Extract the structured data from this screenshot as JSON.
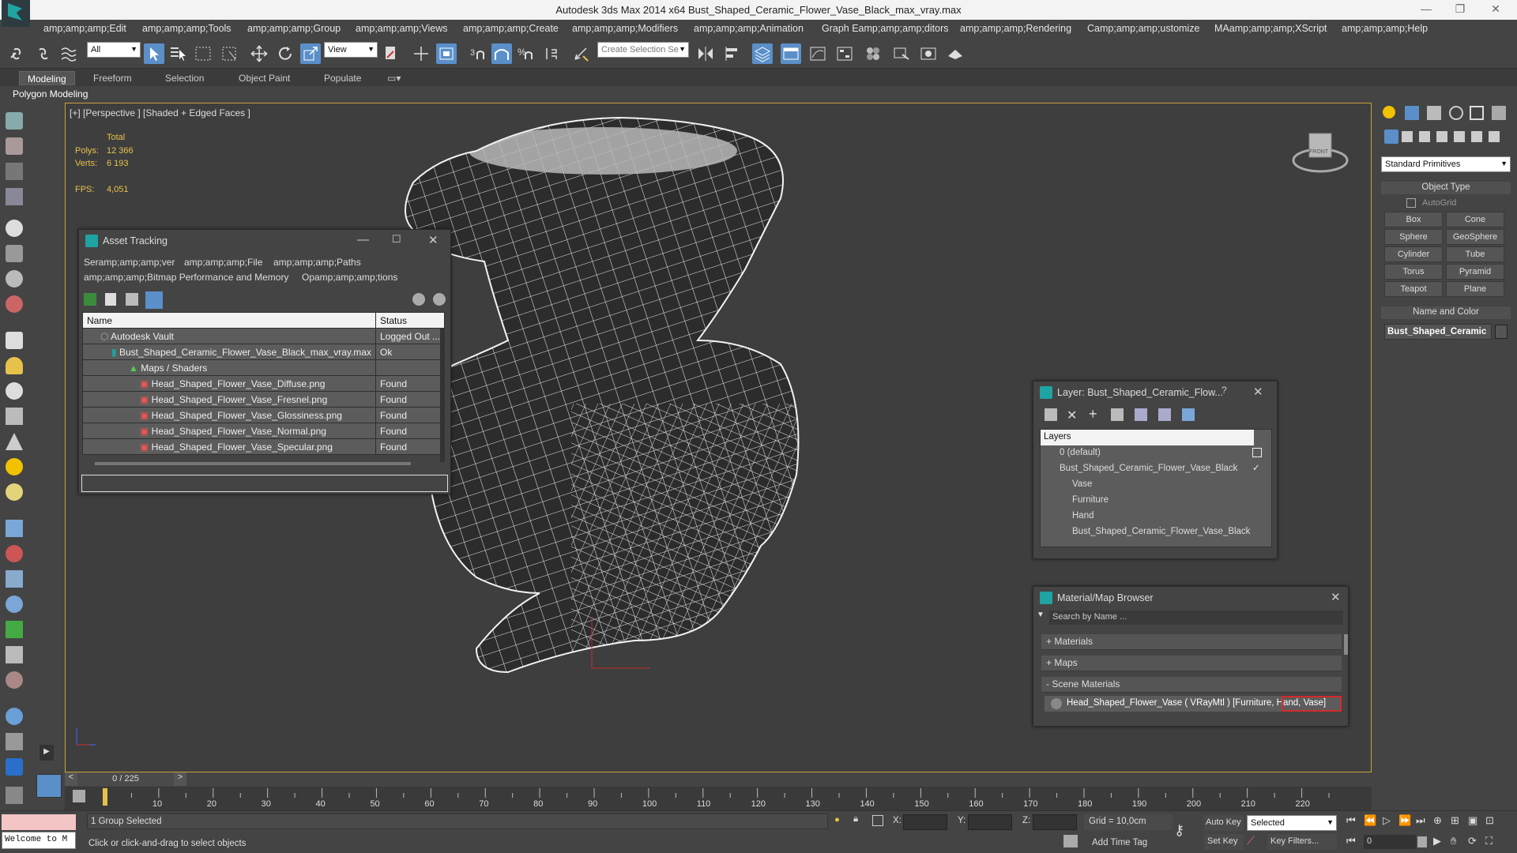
{
  "window": {
    "title": "Autodesk 3ds Max  2014 x64     Bust_Shaped_Ceramic_Flower_Vase_Black_max_vray.max"
  },
  "menu": [
    "amp;amp;amp;Edit",
    "amp;amp;amp;Tools",
    "amp;amp;amp;Group",
    "amp;amp;amp;Views",
    "amp;amp;amp;Create",
    "amp;amp;amp;Modifiers",
    "amp;amp;amp;Animation",
    "Graph Eamp;amp;amp;ditors",
    "amp;amp;amp;Rendering",
    "Camp;amp;amp;ustomize",
    "MAamp;amp;amp;XScript",
    "amp;amp;amp;Help"
  ],
  "toolbar": {
    "selection_filter": "All",
    "ref_coord": "View",
    "named_selection_placeholder": "Create Selection Se"
  },
  "ribbon": {
    "tabs": [
      "Modeling",
      "Freeform",
      "Selection",
      "Object Paint",
      "Populate"
    ],
    "active": "Modeling",
    "sub_label": "Polygon Modeling"
  },
  "viewport": {
    "label": "[+] [Perspective ] [Shaded + Edged Faces ]",
    "stats": {
      "total_label": "Total",
      "polys_label": "Polys:",
      "polys": "12 366",
      "verts_label": "Verts:",
      "verts": "6 193",
      "fps_label": "FPS:",
      "fps": "4,051"
    },
    "viewcube_label": "FRONT"
  },
  "asset_tracking": {
    "title": "Asset Tracking",
    "menu_row1": [
      "Seramp;amp;amp;ver",
      "amp;amp;amp;File",
      "amp;amp;amp;Paths"
    ],
    "menu_row2": [
      "amp;amp;amp;Bitmap Performance and Memory",
      "Opamp;amp;amp;tions"
    ],
    "columns": [
      "Name",
      "Status"
    ],
    "rows": [
      {
        "name": "Autodesk Vault",
        "status": "Logged Out ..."
      },
      {
        "name": "Bust_Shaped_Ceramic_Flower_Vase_Black_max_vray.max",
        "status": "Ok"
      },
      {
        "name": "Maps / Shaders",
        "status": ""
      },
      {
        "name": "Head_Shaped_Flower_Vase_Diffuse.png",
        "status": "Found"
      },
      {
        "name": "Head_Shaped_Flower_Vase_Fresnel.png",
        "status": "Found"
      },
      {
        "name": "Head_Shaped_Flower_Vase_Glossiness.png",
        "status": "Found"
      },
      {
        "name": "Head_Shaped_Flower_Vase_Normal.png",
        "status": "Found"
      },
      {
        "name": "Head_Shaped_Flower_Vase_Specular.png",
        "status": "Found"
      }
    ]
  },
  "layer_dialog": {
    "title": "Layer: Bust_Shaped_Ceramic_Flow...",
    "help": "?",
    "header": "Layers",
    "layers": [
      "0 (default)",
      "Bust_Shaped_Ceramic_Flower_Vase_Black",
      "Vase",
      "Furniture",
      "Hand",
      "Bust_Shaped_Ceramic_Flower_Vase_Black"
    ]
  },
  "material_browser": {
    "title": "Material/Map Browser",
    "search_placeholder": "Search by Name ...",
    "sections": [
      "+ Materials",
      "+ Maps",
      "- Scene Materials"
    ],
    "scene_material": "Head_Shaped_Flower_Vase  ( VRayMtl )  [Furniture, Hand, Vase]"
  },
  "command_panel": {
    "category": "Standard Primitives",
    "object_type_title": "Object Type",
    "autogrid": "AutoGrid",
    "buttons": [
      "Box",
      "Cone",
      "Sphere",
      "GeoSphere",
      "Cylinder",
      "Tube",
      "Torus",
      "Pyramid",
      "Teapot",
      "Plane"
    ],
    "name_color_title": "Name and Color",
    "object_name": "Bust_Shaped_Ceramic"
  },
  "timeline": {
    "frame_display": "0 / 225",
    "prev": "<",
    "next": ">",
    "ticks": [
      "10",
      "20",
      "30",
      "40",
      "50",
      "60",
      "70",
      "80",
      "90",
      "100",
      "110",
      "120",
      "130",
      "140",
      "150",
      "160",
      "170",
      "180",
      "190",
      "200",
      "210",
      "220"
    ]
  },
  "status": {
    "maxscript": "Welcome to M",
    "selection": "1 Group Selected",
    "prompt": "Click or click-and-drag to select objects",
    "x_label": "X:",
    "y_label": "Y:",
    "z_label": "Z:",
    "grid": "Grid = 10,0cm",
    "add_time_tag": "Add Time Tag",
    "auto_key": "Auto Key",
    "set_key": "Set Key",
    "key_mode": "Selected",
    "key_filters": "Key Filters...",
    "frame": "0"
  },
  "colors": {
    "accent": "#5a8fc9",
    "viewport_border": "#c8a13a",
    "stats": "#e6c24a",
    "material_highlight": "#d42a2a"
  }
}
